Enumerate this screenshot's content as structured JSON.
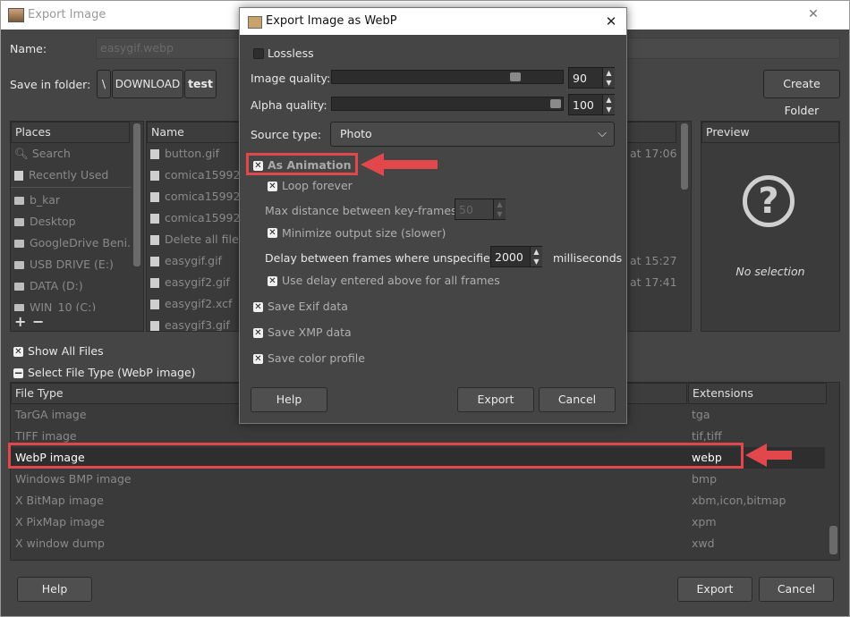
{
  "window": {
    "title": "Export Image",
    "name_label": "Name:",
    "name_value": "easygif.webp",
    "folder_label": "Save in folder:",
    "breadcrumb": [
      "\\",
      "DOWNLOAD",
      "test"
    ],
    "create_folder": "Create Folder",
    "places_header": "Places",
    "places": [
      {
        "label": "Search",
        "icon": "search-icon"
      },
      {
        "label": "Recently Used",
        "icon": "recent-icon"
      },
      {
        "label": "b_kar",
        "icon": "folder-icon"
      },
      {
        "label": "Desktop",
        "icon": "folder-icon"
      },
      {
        "label": "GoogleDrive Beni...",
        "icon": "drive-icon"
      },
      {
        "label": "USB DRIVE (E:)",
        "icon": "drive-icon"
      },
      {
        "label": "DATA (D:)",
        "icon": "drive-icon"
      },
      {
        "label": "WIN_10 (C:)",
        "icon": "drive-icon"
      }
    ],
    "files_header": "Name",
    "files": [
      {
        "name": "button.gif",
        "time": "at 17:06"
      },
      {
        "name": "comica159928(",
        "time": ""
      },
      {
        "name": "comica159928(",
        "time": ""
      },
      {
        "name": "comica159928(",
        "time": ""
      },
      {
        "name": "Delete all files o",
        "time": ""
      },
      {
        "name": "easygif.gif",
        "time": "at 15:27"
      },
      {
        "name": "easygif2.gif",
        "time": "at 17:41"
      },
      {
        "name": "easygif2.xcf",
        "time": ""
      },
      {
        "name": "easygif3.gif",
        "time": ""
      }
    ],
    "preview_header": "Preview",
    "preview_text": "No selection",
    "show_all_files": "Show All Files",
    "select_type": "Select File Type (WebP image)",
    "type_header": "File Type",
    "ext_header": "Extensions",
    "types": [
      {
        "type": "TarGA image",
        "ext": "tga"
      },
      {
        "type": "TIFF image",
        "ext": "tif,tiff"
      },
      {
        "type": "WebP image",
        "ext": "webp"
      },
      {
        "type": "Windows BMP image",
        "ext": "bmp"
      },
      {
        "type": "X BitMap image",
        "ext": "xbm,icon,bitmap"
      },
      {
        "type": "X PixMap image",
        "ext": "xpm"
      },
      {
        "type": "X window dump",
        "ext": "xwd"
      }
    ],
    "help": "Help",
    "export": "Export",
    "cancel": "Cancel"
  },
  "dialog": {
    "title": "Export Image as WebP",
    "lossless": "Lossless",
    "image_quality_label": "Image quality:",
    "image_quality": "90",
    "image_quality_fraction": 0.9,
    "alpha_quality_label": "Alpha quality:",
    "alpha_quality": "100",
    "alpha_quality_fraction": 1.0,
    "source_type_label": "Source type:",
    "source_type": "Photo",
    "as_animation": "As Animation",
    "loop_forever": "Loop forever",
    "max_distance_label": "Max distance between key-frames:",
    "max_distance": "50",
    "minimize": "Minimize output size (slower)",
    "delay_label": "Delay between frames where unspecified:",
    "delay": "2000",
    "delay_unit": "milliseconds",
    "use_delay": "Use delay entered above for all frames",
    "save_exif": "Save Exif data",
    "save_xmp": "Save XMP data",
    "save_color": "Save color profile",
    "help": "Help",
    "export": "Export",
    "cancel": "Cancel"
  },
  "colors": {
    "highlight": "#e2474b",
    "background": "#454545"
  }
}
